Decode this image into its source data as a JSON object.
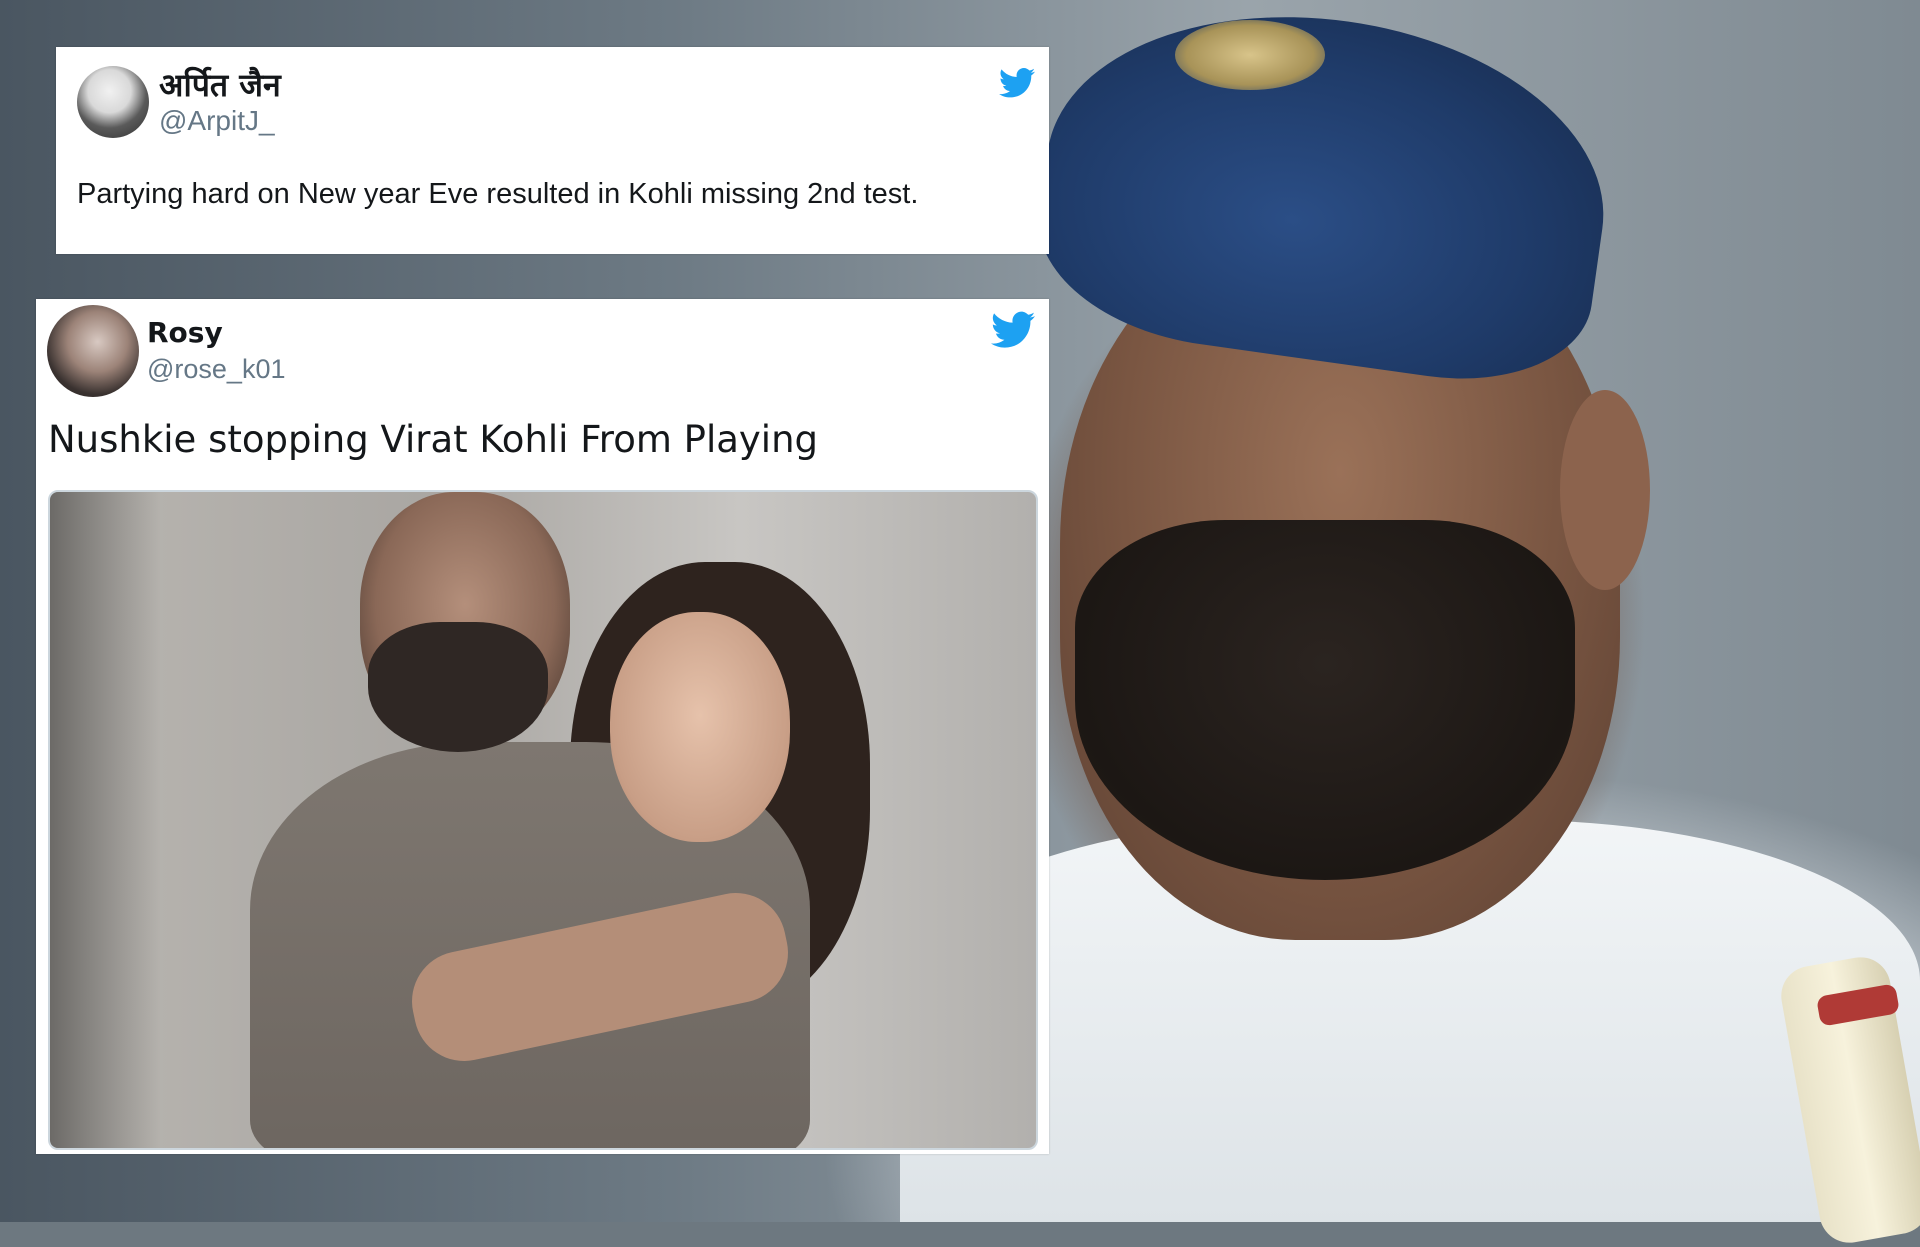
{
  "tweets": [
    {
      "display_name": "अर्पित जैन",
      "handle": "@ArpitJ_",
      "text": "Partying hard on New year Eve resulted in Kohli missing 2nd test."
    },
    {
      "display_name": "Rosy",
      "handle": "@rose_k01",
      "text": "Nushkie stopping Virat Kohli From Playing"
    }
  ],
  "colors": {
    "twitter_blue": "#1da1f2",
    "text_primary": "#14171a",
    "text_secondary": "#657786"
  },
  "icons": {
    "brand": "twitter-bird-icon"
  }
}
